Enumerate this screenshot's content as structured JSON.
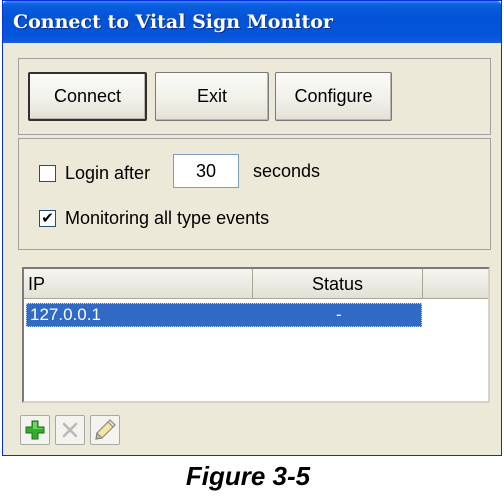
{
  "window": {
    "title": "Connect to Vital Sign Monitor"
  },
  "buttons": {
    "connect": "Connect",
    "exit": "Exit",
    "configure": "Configure"
  },
  "options": {
    "login_after": {
      "label": "Login after",
      "checked": false,
      "value": "30",
      "unit": "seconds"
    },
    "monitoring": {
      "label": "Monitoring all type events",
      "checked": true,
      "check_glyph": "✔"
    }
  },
  "table": {
    "columns": [
      "IP",
      "Status"
    ],
    "rows": [
      {
        "ip": "127.0.0.1",
        "status": "-",
        "selected": true
      }
    ]
  },
  "toolbar": {
    "icons": [
      "add-icon",
      "delete-icon",
      "edit-icon"
    ]
  },
  "caption": "Figure 3-5",
  "colors": {
    "title_bar": "#0454dc",
    "selection": "#316ac5",
    "dialog_bg": "#ece9d8",
    "add_green": "#2fae2a"
  }
}
